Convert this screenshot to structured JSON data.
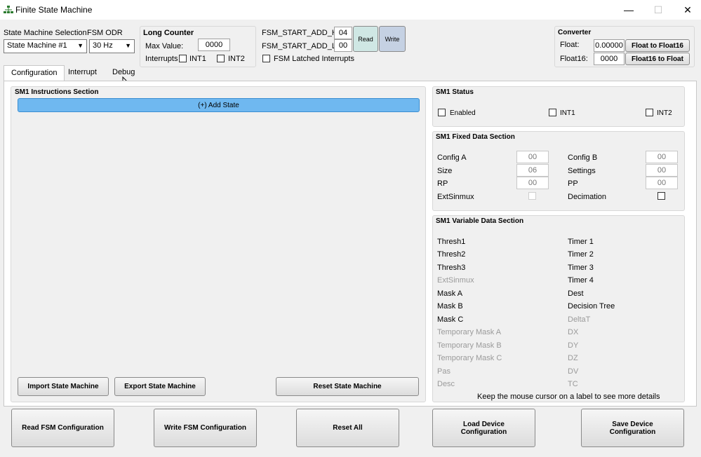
{
  "window": {
    "title": "Finite State Machine",
    "minimize": "—",
    "maximize": "☐",
    "close": "✕"
  },
  "top": {
    "sm_selection_label": "State Machine Selection",
    "sm_selection_value": "State Machine #1",
    "odr_label": "FSM ODR",
    "odr_value": "30 Hz",
    "long_counter_title": "Long Counter",
    "max_value_label": "Max Value:",
    "max_value": "0000",
    "interrupts_label": "Interrupts",
    "int1_label": "INT1",
    "int2_label": "INT2",
    "start_add_h_label": "FSM_START_ADD_H:",
    "start_add_h_value": "04",
    "start_add_l_label": "FSM_START_ADD_L:",
    "start_add_l_value": "00",
    "read_label": "Read",
    "write_label": "Write",
    "latched_label": "FSM Latched Interrupts",
    "converter_title": "Converter",
    "float_label": "Float:",
    "float_value": "0.00000",
    "float_btn": "Float to Float16",
    "float16_label": "Float16:",
    "float16_value": "0000",
    "float16_btn": "Float16 to Float"
  },
  "tabs": [
    "Configuration",
    "Interrupt",
    "Debug"
  ],
  "instructions": {
    "title": "SM1 Instructions Section",
    "add_state": "(+) Add State",
    "import_btn": "Import State Machine",
    "export_btn": "Export State Machine",
    "reset_btn": "Reset State Machine"
  },
  "status": {
    "title": "SM1 Status",
    "enabled": "Enabled",
    "int1": "INT1",
    "int2": "INT2"
  },
  "fixed": {
    "title": "SM1 Fixed Data Section",
    "config_a": "Config A",
    "config_a_val": "00",
    "config_b": "Config B",
    "config_b_val": "00",
    "size": "Size",
    "size_val": "06",
    "settings": "Settings",
    "settings_val": "00",
    "rp": "RP",
    "rp_val": "00",
    "pp": "PP",
    "pp_val": "00",
    "extsinmux": "ExtSinmux",
    "decimation": "Decimation"
  },
  "variable": {
    "title": "SM1 Variable Data Section",
    "left": [
      "Thresh1",
      "Thresh2",
      "Thresh3",
      "ExtSinmux",
      "Mask A",
      "Mask B",
      "Mask C",
      "Temporary Mask A",
      "Temporary Mask B",
      "Temporary Mask C",
      "Pas",
      "Desc"
    ],
    "right": [
      "Timer 1",
      "Timer 2",
      "Timer 3",
      "Timer 4",
      "Dest",
      "Decision Tree",
      "DeltaT",
      "DX",
      "DY",
      "DZ",
      "DV",
      "TC"
    ],
    "hint": "Keep the mouse cursor on a label to see more details"
  },
  "bottom": {
    "read_fsm": "Read FSM Configuration",
    "write_fsm": "Write FSM Configuration",
    "reset_all": "Reset All",
    "load_device": "Load Device Configuration",
    "save_device": "Save Device Configuration"
  },
  "colors": {
    "add_state_bg": "#6fb8f0",
    "read_btn_bg": "#cfe7e4",
    "write_btn_bg": "#c5d1e3"
  }
}
